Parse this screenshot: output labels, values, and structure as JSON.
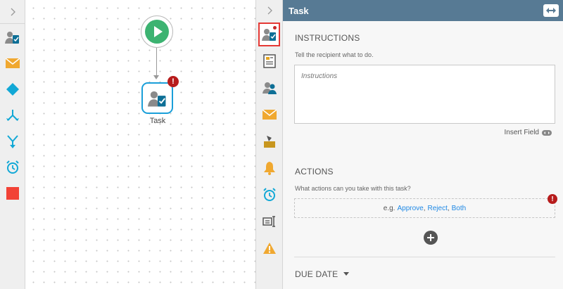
{
  "toolbox": {
    "items": [
      "task-tool",
      "email-tool",
      "decision-tool",
      "split-tool",
      "merge-tool",
      "timer-tool",
      "end-tool"
    ]
  },
  "canvas": {
    "task_label": "Task",
    "error_mark": "!"
  },
  "panel": {
    "title": "Task",
    "instructions": {
      "title": "INSTRUCTIONS",
      "hint": "Tell the recipient what to do.",
      "placeholder": "Instructions",
      "insert_field": "Insert Field"
    },
    "actions": {
      "title": "ACTIONS",
      "hint": "What actions can you take with this task?",
      "example_prefix": "e.g.",
      "examples": [
        "Approve",
        "Reject",
        "Both"
      ],
      "error_mark": "!"
    },
    "due_date": {
      "title": "DUE DATE"
    }
  },
  "colors": {
    "header": "#577a94",
    "accent_blue": "#1a9fd9",
    "error_red": "#b71c1c",
    "start_green": "#3cb371"
  }
}
